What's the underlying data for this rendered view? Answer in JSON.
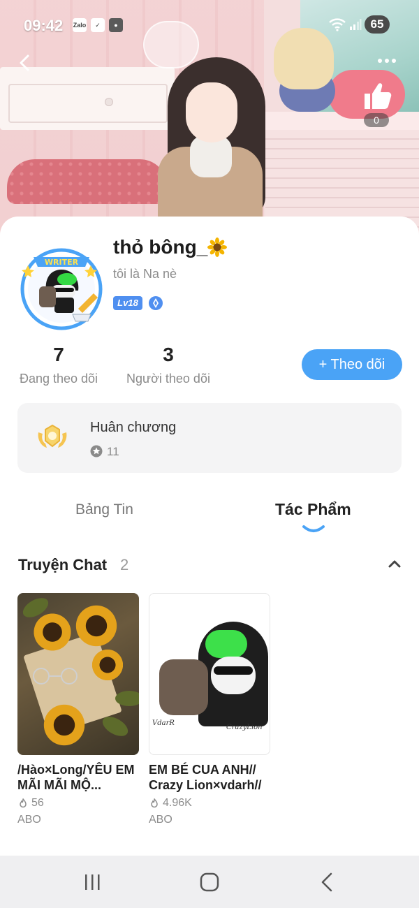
{
  "status_bar": {
    "time": "09:42",
    "app_badges": [
      "Zalo",
      "check-icon",
      "camera-icon"
    ],
    "battery": "65"
  },
  "header": {
    "like_count": "0"
  },
  "profile": {
    "name": "thỏ bông_",
    "name_emoji_icon": "sunflower-icon",
    "bio": "tôi là Na nè",
    "level": "Lv18",
    "avatar_badge_text": "WRITER"
  },
  "stats": {
    "following_count": "7",
    "following_label": "Đang theo dõi",
    "followers_count": "3",
    "followers_label": "Người theo dõi"
  },
  "follow_button": {
    "label": "+ Theo dõi"
  },
  "medals": {
    "title": "Huân chương",
    "count": "11"
  },
  "tabs": [
    {
      "label": "Bảng Tin",
      "active": false
    },
    {
      "label": "Tác Phẩm",
      "active": true
    }
  ],
  "section": {
    "title": "Truyện Chat",
    "count": "2"
  },
  "stories": [
    {
      "title": "/Hào×Long/YÊU EM MÃI MÃI MỘ...",
      "reads": "56",
      "tag": "ABO",
      "cover_caption_left": "",
      "cover_caption_right": ""
    },
    {
      "title": "EM BÉ CUA ANH// Crazy Lion×vdarh//",
      "reads": "4.96K",
      "tag": "ABO",
      "cover_caption_left": "VdarR",
      "cover_caption_right": "CrazyLion"
    }
  ],
  "colors": {
    "accent": "#4aa3f6",
    "level_badge": "#4f8ff0",
    "card_bg": "#ffffff",
    "medal_bg": "#f4f4f5"
  }
}
